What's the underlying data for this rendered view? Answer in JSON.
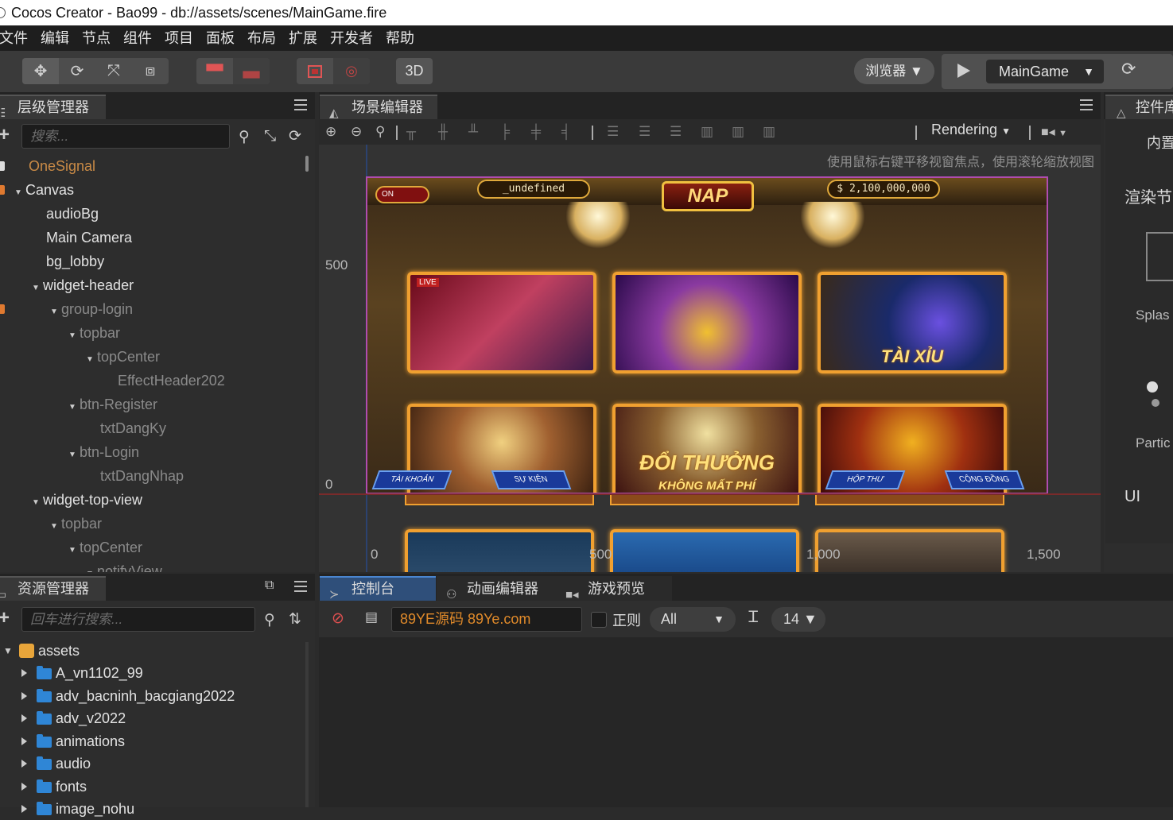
{
  "window": {
    "title": "Cocos Creator - Bao99 - db://assets/scenes/MainGame.fire"
  },
  "menu": [
    "文件",
    "编辑",
    "节点",
    "组件",
    "项目",
    "面板",
    "布局",
    "扩展",
    "开发者",
    "帮助"
  ],
  "toolbar": {
    "mode_3d": "3D",
    "preview_target": "浏览器 ▼",
    "scene_name": "MainGame",
    "scene_caret": "▼"
  },
  "hierarchy": {
    "tab_label": "层级管理器",
    "search_placeholder": "搜索...",
    "nodes": [
      {
        "label": "OneSignal"
      },
      {
        "label": "Canvas"
      },
      {
        "label": "audioBg"
      },
      {
        "label": "Main Camera"
      },
      {
        "label": "bg_lobby"
      },
      {
        "label": "widget-header"
      },
      {
        "label": "group-login"
      },
      {
        "label": "topbar"
      },
      {
        "label": "topCenter"
      },
      {
        "label": "EffectHeader202"
      },
      {
        "label": "btn-Register"
      },
      {
        "label": "txtDangKy"
      },
      {
        "label": "btn-Login"
      },
      {
        "label": "txtDangNhap"
      },
      {
        "label": "widget-top-view"
      },
      {
        "label": "topbar"
      },
      {
        "label": "topCenter"
      },
      {
        "label": "notifyView"
      }
    ]
  },
  "scene_editor": {
    "tab_label": "场景编辑器",
    "render_mode": "Rendering",
    "hint": "使用鼠标右键平移视窗焦点，使用滚轮缩放视图",
    "axis": {
      "y_500": "500",
      "y_0": "0",
      "x_0": "0",
      "x_500": "500",
      "x_1000": "1,000",
      "x_1500": "1,500"
    },
    "game": {
      "username": "_undefined",
      "balance": "$ 2,100,000,000",
      "nap": "NAP",
      "on_label": "ON",
      "live": "LIVE",
      "card_tai_xiu": "TÀI XỈU",
      "doi_thuong": "ĐỔI THƯỞNG",
      "khong_mat_phi": "KHÔNG MẤT PHÍ",
      "tai_khoan": "TÀI KHOẢN",
      "su_kien": "SỰ KIỆN",
      "hop_thu": "HỘP THƯ",
      "cong_dong": "CỘNG ĐỒNG"
    }
  },
  "library": {
    "tab_label": "控件库",
    "builtin": "内置",
    "render_node": "渲染节",
    "splash": "Splas",
    "particle": "Partic",
    "ui": "UI"
  },
  "assets": {
    "tab_label": "资源管理器",
    "search_placeholder": "回车进行搜索...",
    "root": "assets",
    "folders": [
      "A_vn1102_99",
      "adv_bacninh_bacgiang2022",
      "adv_v2022",
      "animations",
      "audio",
      "fonts",
      "image_nohu"
    ]
  },
  "console": {
    "tabs": [
      "控制台",
      "动画编辑器",
      "游戏预览"
    ],
    "filter_value": "89YE源码 89Ye.com",
    "regex_label": "正则",
    "level": "All",
    "level_caret": "▼",
    "font_size": "14 ▼"
  },
  "colors": {
    "accent": "#4a86d0",
    "prefab_orange": "#c98a46",
    "folder_blue": "#2f86d6",
    "filter_orange": "#e08a2a",
    "scene_bounds": "#b04cb0"
  }
}
